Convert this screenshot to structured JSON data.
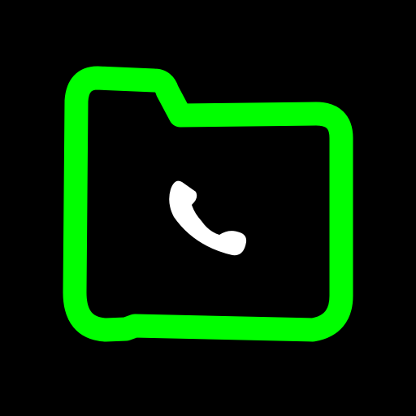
{
  "icon": {
    "name": "call-folder-icon",
    "colors": {
      "background": "#000000",
      "folder_outline": "#00FF00",
      "phone": "#FFFFFF"
    },
    "parts": [
      "folder-icon",
      "phone-handset-icon"
    ]
  }
}
